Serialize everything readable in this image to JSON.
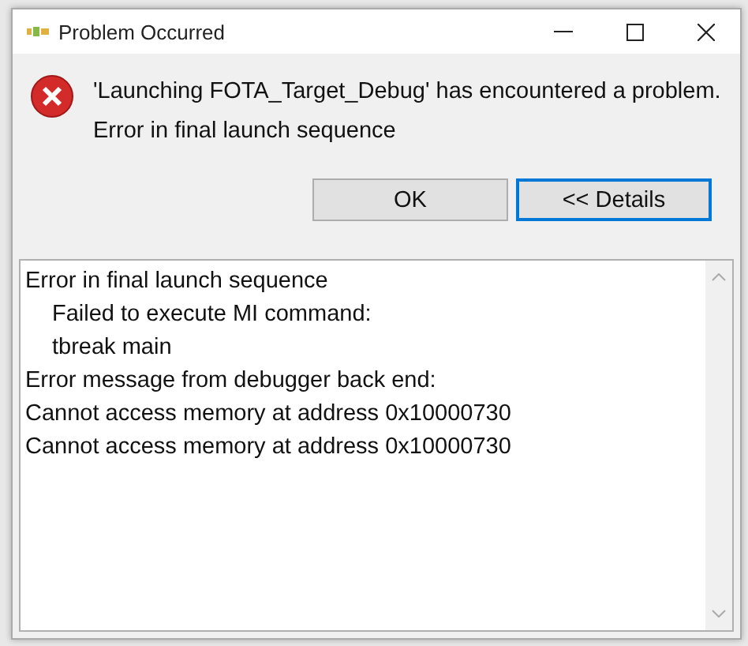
{
  "window": {
    "title": "Problem Occurred"
  },
  "message": {
    "title": "'Launching FOTA_Target_Debug' has encountered a problem.",
    "text": "Error in final launch sequence"
  },
  "buttons": [
    {
      "label": "OK",
      "focused": false
    },
    {
      "label": "<< Details",
      "focused": true
    }
  ],
  "details": [
    {
      "text": "Error in final launch sequence",
      "indented": false
    },
    {
      "text": "Failed to execute MI command:",
      "indented": true
    },
    {
      "text": "tbreak main",
      "indented": true
    },
    {
      "text": "Error message from debugger back end:",
      "indented": false
    },
    {
      "text": "Cannot access memory at address 0x10000730",
      "indented": false
    },
    {
      "text": "Cannot access memory at address 0x10000730",
      "indented": false
    }
  ]
}
